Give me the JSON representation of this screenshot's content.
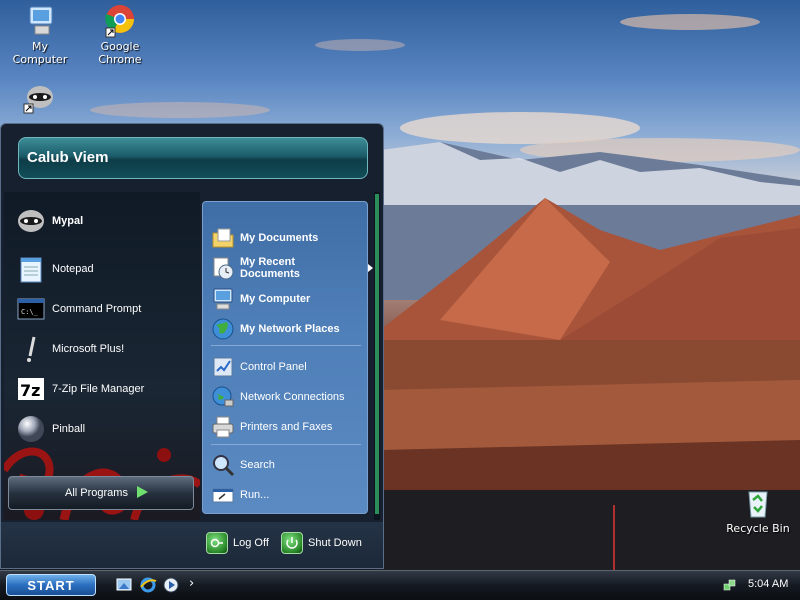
{
  "desktop": {
    "icons": [
      {
        "label": "My Computer",
        "icon": "my-computer-icon"
      },
      {
        "label": "Google Chrome",
        "icon": "chrome-icon"
      },
      {
        "label": "",
        "icon": "mypal-raccoon-icon"
      },
      {
        "label": "Recycle Bin",
        "icon": "recycle-bin-icon"
      }
    ]
  },
  "start_menu": {
    "user_name": "Calub Viem",
    "pinned": [
      {
        "label": "Mypal",
        "icon": "mypal-raccoon-icon",
        "bold": true
      },
      {
        "label": "Notepad",
        "icon": "notepad-icon"
      },
      {
        "label": "Command Prompt",
        "icon": "command-prompt-icon"
      },
      {
        "label": "Microsoft Plus!",
        "icon": "microsoft-plus-icon"
      },
      {
        "label": "7-Zip File Manager",
        "icon": "7zip-icon"
      },
      {
        "label": "Pinball",
        "icon": "pinball-icon"
      }
    ],
    "all_programs_label": "All Programs",
    "right": {
      "my_documents": "My Documents",
      "my_recent_documents": "My Recent Documents",
      "my_computer": "My Computer",
      "my_network_places": "My Network Places",
      "control_panel": "Control Panel",
      "network_connections": "Network Connections",
      "printers_and_faxes": "Printers and Faxes",
      "search": "Search",
      "run": "Run..."
    },
    "footer": {
      "log_off": "Log Off",
      "shut_down": "Shut Down"
    }
  },
  "taskbar": {
    "start_label": "START",
    "quick_launch": [
      "show-desktop-icon",
      "internet-explorer-icon",
      "media-player-icon"
    ],
    "overflow": "›",
    "clock": "5:04 AM"
  },
  "colors": {
    "start_button": "#2b6fbf",
    "right_panel": "#4f7fb8",
    "header": "#1c5c6a",
    "footer_buttons": "#2a8a2a"
  }
}
